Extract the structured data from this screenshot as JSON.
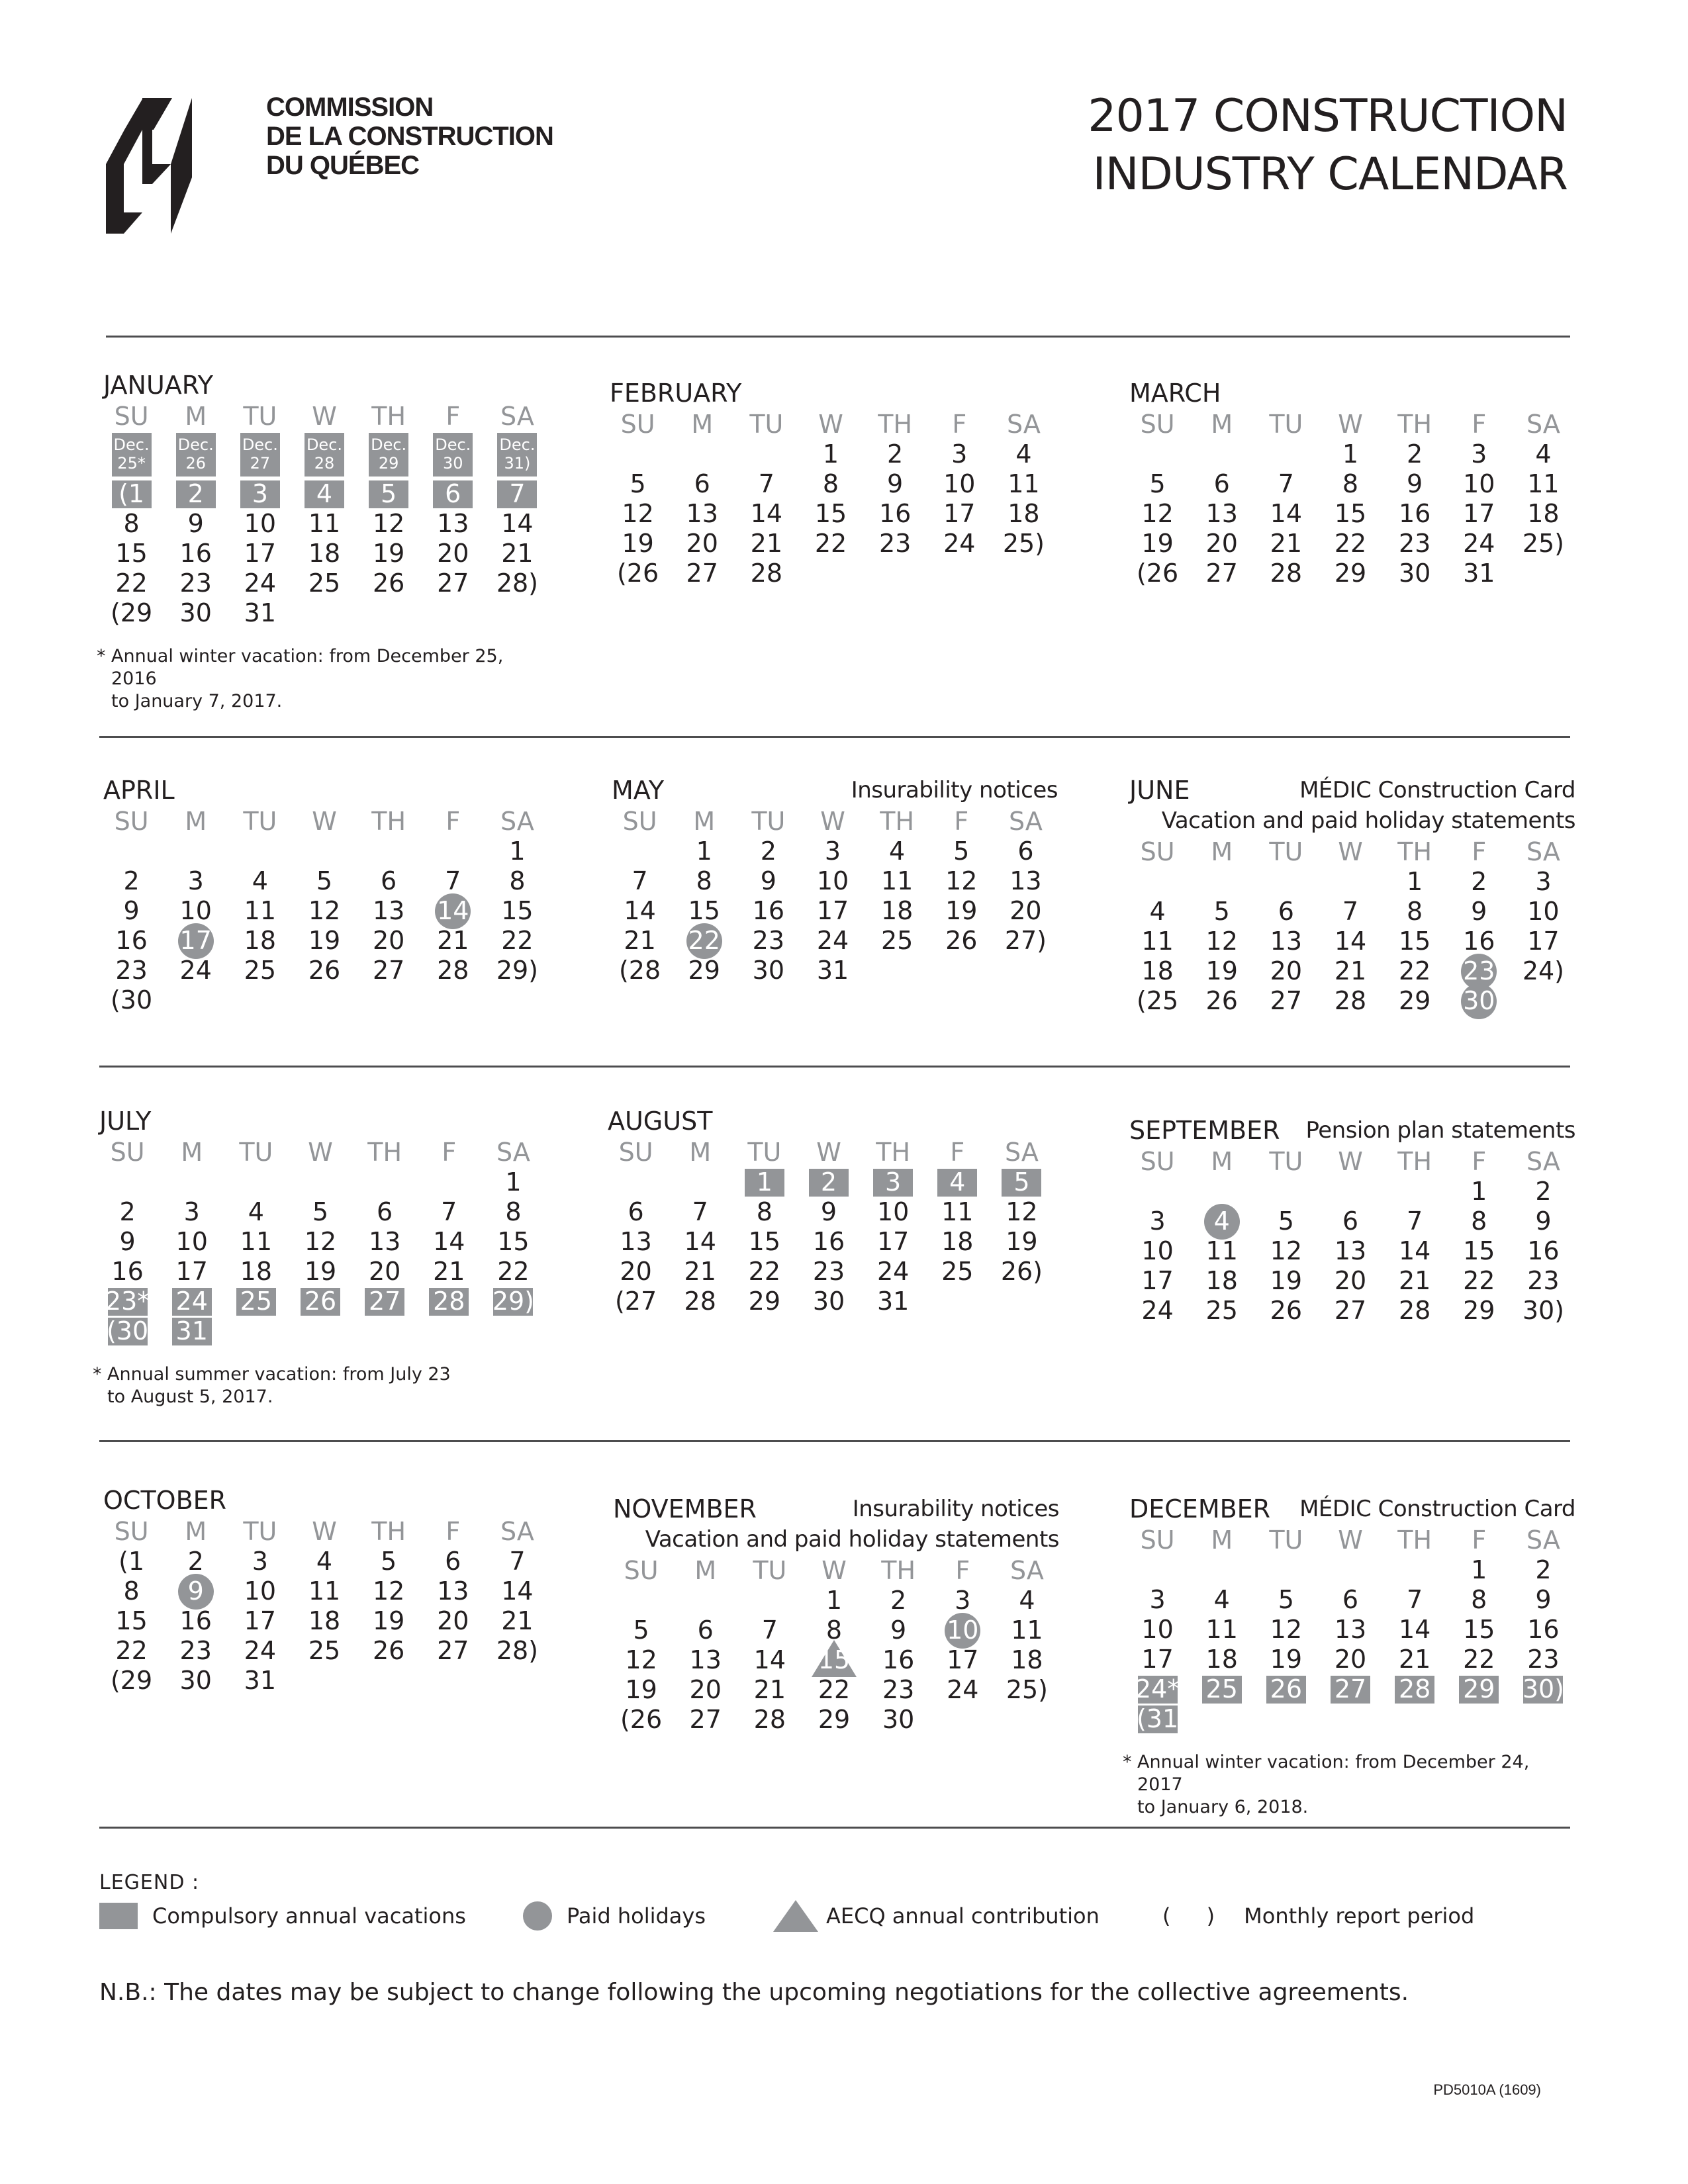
{
  "header": {
    "org_name": [
      "COMMISSION",
      "DE LA CONSTRUCTION",
      "DU QUÉBEC"
    ],
    "title_lines": [
      "2017 CONSTRUCTION",
      "INDUSTRY CALENDAR"
    ],
    "logo_icon": "ccq-logo-icon"
  },
  "weekdays": [
    "SU",
    "M",
    "TU",
    "W",
    "TH",
    "F",
    "SA"
  ],
  "colors": {
    "marker_gray": "#939598",
    "text": "#231f20",
    "weekday_gray": "#939598"
  },
  "months": [
    {
      "name": "JANUARY",
      "notes": [],
      "offset": 0,
      "prev_row": [
        "Dec. 25*",
        "Dec. 26",
        "Dec. 27",
        "Dec. 28",
        "Dec. 29",
        "Dec. 30",
        "Dec. 31)"
      ],
      "days": [
        {
          "t": "(1",
          "m": "vac"
        },
        {
          "t": "2",
          "m": "vac"
        },
        {
          "t": "3",
          "m": "vac"
        },
        {
          "t": "4",
          "m": "vac"
        },
        {
          "t": "5",
          "m": "vac"
        },
        {
          "t": "6",
          "m": "vac"
        },
        {
          "t": "7",
          "m": "vac"
        },
        {
          "t": "8"
        },
        {
          "t": "9"
        },
        {
          "t": "10"
        },
        {
          "t": "11"
        },
        {
          "t": "12"
        },
        {
          "t": "13"
        },
        {
          "t": "14"
        },
        {
          "t": "15"
        },
        {
          "t": "16"
        },
        {
          "t": "17"
        },
        {
          "t": "18"
        },
        {
          "t": "19"
        },
        {
          "t": "20"
        },
        {
          "t": "21"
        },
        {
          "t": "22"
        },
        {
          "t": "23"
        },
        {
          "t": "24"
        },
        {
          "t": "25"
        },
        {
          "t": "26"
        },
        {
          "t": "27"
        },
        {
          "t": "28)"
        },
        {
          "t": "(29"
        },
        {
          "t": "30"
        },
        {
          "t": "31"
        }
      ],
      "footnote": [
        "Annual winter vacation: from December 25, 2016",
        "to January 7, 2017."
      ]
    },
    {
      "name": "FEBRUARY",
      "notes": [],
      "offset": 3,
      "days": [
        {
          "t": "1"
        },
        {
          "t": "2"
        },
        {
          "t": "3"
        },
        {
          "t": "4"
        },
        {
          "t": "5"
        },
        {
          "t": "6"
        },
        {
          "t": "7"
        },
        {
          "t": "8"
        },
        {
          "t": "9"
        },
        {
          "t": "10"
        },
        {
          "t": "11"
        },
        {
          "t": "12"
        },
        {
          "t": "13"
        },
        {
          "t": "14"
        },
        {
          "t": "15"
        },
        {
          "t": "16"
        },
        {
          "t": "17"
        },
        {
          "t": "18"
        },
        {
          "t": "19"
        },
        {
          "t": "20"
        },
        {
          "t": "21"
        },
        {
          "t": "22"
        },
        {
          "t": "23"
        },
        {
          "t": "24"
        },
        {
          "t": "25)"
        },
        {
          "t": "(26"
        },
        {
          "t": "27"
        },
        {
          "t": "28"
        }
      ]
    },
    {
      "name": "MARCH",
      "notes": [],
      "offset": 3,
      "days": [
        {
          "t": "1"
        },
        {
          "t": "2"
        },
        {
          "t": "3"
        },
        {
          "t": "4"
        },
        {
          "t": "5"
        },
        {
          "t": "6"
        },
        {
          "t": "7"
        },
        {
          "t": "8"
        },
        {
          "t": "9"
        },
        {
          "t": "10"
        },
        {
          "t": "11"
        },
        {
          "t": "12"
        },
        {
          "t": "13"
        },
        {
          "t": "14"
        },
        {
          "t": "15"
        },
        {
          "t": "16"
        },
        {
          "t": "17"
        },
        {
          "t": "18"
        },
        {
          "t": "19"
        },
        {
          "t": "20"
        },
        {
          "t": "21"
        },
        {
          "t": "22"
        },
        {
          "t": "23"
        },
        {
          "t": "24"
        },
        {
          "t": "25)"
        },
        {
          "t": "(26"
        },
        {
          "t": "27"
        },
        {
          "t": "28"
        },
        {
          "t": "29"
        },
        {
          "t": "30"
        },
        {
          "t": "31"
        }
      ]
    },
    {
      "name": "APRIL",
      "notes": [],
      "offset": 6,
      "days": [
        {
          "t": "1"
        },
        {
          "t": "2"
        },
        {
          "t": "3"
        },
        {
          "t": "4"
        },
        {
          "t": "5"
        },
        {
          "t": "6"
        },
        {
          "t": "7"
        },
        {
          "t": "8"
        },
        {
          "t": "9"
        },
        {
          "t": "10"
        },
        {
          "t": "11"
        },
        {
          "t": "12"
        },
        {
          "t": "13"
        },
        {
          "t": "14",
          "m": "hol"
        },
        {
          "t": "15"
        },
        {
          "t": "16"
        },
        {
          "t": "17",
          "m": "hol"
        },
        {
          "t": "18"
        },
        {
          "t": "19"
        },
        {
          "t": "20"
        },
        {
          "t": "21"
        },
        {
          "t": "22"
        },
        {
          "t": "23"
        },
        {
          "t": "24"
        },
        {
          "t": "25"
        },
        {
          "t": "26"
        },
        {
          "t": "27"
        },
        {
          "t": "28"
        },
        {
          "t": "29)"
        },
        {
          "t": "(30"
        }
      ]
    },
    {
      "name": "MAY",
      "notes": [
        "Insurability notices"
      ],
      "offset": 1,
      "days": [
        {
          "t": "1"
        },
        {
          "t": "2"
        },
        {
          "t": "3"
        },
        {
          "t": "4"
        },
        {
          "t": "5"
        },
        {
          "t": "6"
        },
        {
          "t": "7"
        },
        {
          "t": "8"
        },
        {
          "t": "9"
        },
        {
          "t": "10"
        },
        {
          "t": "11"
        },
        {
          "t": "12"
        },
        {
          "t": "13"
        },
        {
          "t": "14"
        },
        {
          "t": "15"
        },
        {
          "t": "16"
        },
        {
          "t": "17"
        },
        {
          "t": "18"
        },
        {
          "t": "19"
        },
        {
          "t": "20"
        },
        {
          "t": "21"
        },
        {
          "t": "22",
          "m": "hol"
        },
        {
          "t": "23"
        },
        {
          "t": "24"
        },
        {
          "t": "25"
        },
        {
          "t": "26"
        },
        {
          "t": "27)"
        },
        {
          "t": "(28"
        },
        {
          "t": "29"
        },
        {
          "t": "30"
        },
        {
          "t": "31"
        }
      ]
    },
    {
      "name": "JUNE",
      "notes": [
        "MÉDIC Construction Card",
        "Vacation and paid holiday statements"
      ],
      "offset": 4,
      "days": [
        {
          "t": "1"
        },
        {
          "t": "2"
        },
        {
          "t": "3"
        },
        {
          "t": "4"
        },
        {
          "t": "5"
        },
        {
          "t": "6"
        },
        {
          "t": "7"
        },
        {
          "t": "8"
        },
        {
          "t": "9"
        },
        {
          "t": "10"
        },
        {
          "t": "11"
        },
        {
          "t": "12"
        },
        {
          "t": "13"
        },
        {
          "t": "14"
        },
        {
          "t": "15"
        },
        {
          "t": "16"
        },
        {
          "t": "17"
        },
        {
          "t": "18"
        },
        {
          "t": "19"
        },
        {
          "t": "20"
        },
        {
          "t": "21"
        },
        {
          "t": "22"
        },
        {
          "t": "23",
          "m": "hol"
        },
        {
          "t": "24)"
        },
        {
          "t": "(25"
        },
        {
          "t": "26"
        },
        {
          "t": "27"
        },
        {
          "t": "28"
        },
        {
          "t": "29"
        },
        {
          "t": "30",
          "m": "hol"
        }
      ]
    },
    {
      "name": "JULY",
      "notes": [],
      "offset": 6,
      "days": [
        {
          "t": "1"
        },
        {
          "t": "2"
        },
        {
          "t": "3"
        },
        {
          "t": "4"
        },
        {
          "t": "5"
        },
        {
          "t": "6"
        },
        {
          "t": "7"
        },
        {
          "t": "8"
        },
        {
          "t": "9"
        },
        {
          "t": "10"
        },
        {
          "t": "11"
        },
        {
          "t": "12"
        },
        {
          "t": "13"
        },
        {
          "t": "14"
        },
        {
          "t": "15"
        },
        {
          "t": "16"
        },
        {
          "t": "17"
        },
        {
          "t": "18"
        },
        {
          "t": "19"
        },
        {
          "t": "20"
        },
        {
          "t": "21"
        },
        {
          "t": "22"
        },
        {
          "t": "23*",
          "m": "vac"
        },
        {
          "t": "24",
          "m": "vac"
        },
        {
          "t": "25",
          "m": "vac"
        },
        {
          "t": "26",
          "m": "vac"
        },
        {
          "t": "27",
          "m": "vac"
        },
        {
          "t": "28",
          "m": "vac"
        },
        {
          "t": "29)",
          "m": "vac"
        },
        {
          "t": "(30",
          "m": "vac"
        },
        {
          "t": "31",
          "m": "vac"
        }
      ],
      "footnote": [
        "Annual summer vacation: from July 23",
        "to August 5, 2017."
      ]
    },
    {
      "name": "AUGUST",
      "notes": [],
      "offset": 2,
      "days": [
        {
          "t": "1",
          "m": "vac"
        },
        {
          "t": "2",
          "m": "vac"
        },
        {
          "t": "3",
          "m": "vac"
        },
        {
          "t": "4",
          "m": "vac"
        },
        {
          "t": "5",
          "m": "vac"
        },
        {
          "t": "6"
        },
        {
          "t": "7"
        },
        {
          "t": "8"
        },
        {
          "t": "9"
        },
        {
          "t": "10"
        },
        {
          "t": "11"
        },
        {
          "t": "12"
        },
        {
          "t": "13"
        },
        {
          "t": "14"
        },
        {
          "t": "15"
        },
        {
          "t": "16"
        },
        {
          "t": "17"
        },
        {
          "t": "18"
        },
        {
          "t": "19"
        },
        {
          "t": "20"
        },
        {
          "t": "21"
        },
        {
          "t": "22"
        },
        {
          "t": "23"
        },
        {
          "t": "24"
        },
        {
          "t": "25"
        },
        {
          "t": "26)"
        },
        {
          "t": "(27"
        },
        {
          "t": "28"
        },
        {
          "t": "29"
        },
        {
          "t": "30"
        },
        {
          "t": "31"
        }
      ]
    },
    {
      "name": "SEPTEMBER",
      "notes": [
        "Pension plan statements"
      ],
      "offset": 5,
      "days": [
        {
          "t": "1"
        },
        {
          "t": "2"
        },
        {
          "t": "3"
        },
        {
          "t": "4",
          "m": "hol"
        },
        {
          "t": "5"
        },
        {
          "t": "6"
        },
        {
          "t": "7"
        },
        {
          "t": "8"
        },
        {
          "t": "9"
        },
        {
          "t": "10"
        },
        {
          "t": "11"
        },
        {
          "t": "12"
        },
        {
          "t": "13"
        },
        {
          "t": "14"
        },
        {
          "t": "15"
        },
        {
          "t": "16"
        },
        {
          "t": "17"
        },
        {
          "t": "18"
        },
        {
          "t": "19"
        },
        {
          "t": "20"
        },
        {
          "t": "21"
        },
        {
          "t": "22"
        },
        {
          "t": "23"
        },
        {
          "t": "24"
        },
        {
          "t": "25"
        },
        {
          "t": "26"
        },
        {
          "t": "27"
        },
        {
          "t": "28"
        },
        {
          "t": "29"
        },
        {
          "t": "30)"
        }
      ]
    },
    {
      "name": "OCTOBER",
      "notes": [],
      "offset": 0,
      "days": [
        {
          "t": "(1"
        },
        {
          "t": "2"
        },
        {
          "t": "3"
        },
        {
          "t": "4"
        },
        {
          "t": "5"
        },
        {
          "t": "6"
        },
        {
          "t": "7"
        },
        {
          "t": "8"
        },
        {
          "t": "9",
          "m": "hol"
        },
        {
          "t": "10"
        },
        {
          "t": "11"
        },
        {
          "t": "12"
        },
        {
          "t": "13"
        },
        {
          "t": "14"
        },
        {
          "t": "15"
        },
        {
          "t": "16"
        },
        {
          "t": "17"
        },
        {
          "t": "18"
        },
        {
          "t": "19"
        },
        {
          "t": "20"
        },
        {
          "t": "21"
        },
        {
          "t": "22"
        },
        {
          "t": "23"
        },
        {
          "t": "24"
        },
        {
          "t": "25"
        },
        {
          "t": "26"
        },
        {
          "t": "27"
        },
        {
          "t": "28)"
        },
        {
          "t": "(29"
        },
        {
          "t": "30"
        },
        {
          "t": "31"
        }
      ]
    },
    {
      "name": "NOVEMBER",
      "notes": [
        "Insurability notices",
        "Vacation and paid holiday statements"
      ],
      "offset": 3,
      "days": [
        {
          "t": "1"
        },
        {
          "t": "2"
        },
        {
          "t": "3"
        },
        {
          "t": "4"
        },
        {
          "t": "5"
        },
        {
          "t": "6"
        },
        {
          "t": "7"
        },
        {
          "t": "8"
        },
        {
          "t": "9"
        },
        {
          "t": "10",
          "m": "hol"
        },
        {
          "t": "11"
        },
        {
          "t": "12"
        },
        {
          "t": "13"
        },
        {
          "t": "14"
        },
        {
          "t": "15",
          "m": "aecq"
        },
        {
          "t": "16"
        },
        {
          "t": "17"
        },
        {
          "t": "18"
        },
        {
          "t": "19"
        },
        {
          "t": "20"
        },
        {
          "t": "21"
        },
        {
          "t": "22"
        },
        {
          "t": "23"
        },
        {
          "t": "24"
        },
        {
          "t": "25)"
        },
        {
          "t": "(26"
        },
        {
          "t": "27"
        },
        {
          "t": "28"
        },
        {
          "t": "29"
        },
        {
          "t": "30"
        }
      ]
    },
    {
      "name": "DECEMBER",
      "notes": [
        "MÉDIC Construction Card"
      ],
      "offset": 5,
      "days": [
        {
          "t": "1"
        },
        {
          "t": "2"
        },
        {
          "t": "3"
        },
        {
          "t": "4"
        },
        {
          "t": "5"
        },
        {
          "t": "6"
        },
        {
          "t": "7"
        },
        {
          "t": "8"
        },
        {
          "t": "9"
        },
        {
          "t": "10"
        },
        {
          "t": "11"
        },
        {
          "t": "12"
        },
        {
          "t": "13"
        },
        {
          "t": "14"
        },
        {
          "t": "15"
        },
        {
          "t": "16"
        },
        {
          "t": "17"
        },
        {
          "t": "18"
        },
        {
          "t": "19"
        },
        {
          "t": "20"
        },
        {
          "t": "21"
        },
        {
          "t": "22"
        },
        {
          "t": "23"
        },
        {
          "t": "24*",
          "m": "vac"
        },
        {
          "t": "25",
          "m": "vac"
        },
        {
          "t": "26",
          "m": "vac"
        },
        {
          "t": "27",
          "m": "vac"
        },
        {
          "t": "28",
          "m": "vac"
        },
        {
          "t": "29",
          "m": "vac"
        },
        {
          "t": "30)",
          "m": "vac"
        },
        {
          "t": "(31",
          "m": "vac"
        }
      ],
      "footnote": [
        "Annual winter vacation: from December 24, 2017",
        "to January 6, 2018."
      ]
    }
  ],
  "legend": {
    "title": "LEGEND :",
    "items": [
      {
        "icon": "square-swatch-icon",
        "label": "Compulsory annual vacations"
      },
      {
        "icon": "circle-swatch-icon",
        "label": "Paid holidays"
      },
      {
        "icon": "triangle-swatch-icon",
        "label": "AECQ annual contribution"
      },
      {
        "icon": "parentheses-icon",
        "symbol": "( )",
        "label": "Monthly report period"
      }
    ]
  },
  "nb_text": "N.B.: The dates may be subject to change following the upcoming negotiations for the collective agreements.",
  "doc_code": "PD5010A (1609)"
}
